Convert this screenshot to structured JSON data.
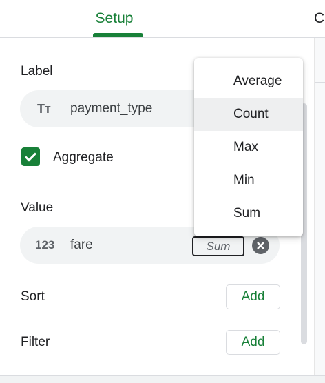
{
  "tabs": [
    {
      "label": "Setup",
      "active": true
    },
    {
      "label": "C",
      "active": false
    }
  ],
  "colors": {
    "accent": "#188038",
    "chip_bg": "#f1f3f4",
    "text": "#202124"
  },
  "label_section": {
    "heading": "Label",
    "field": {
      "icon": "text-type-icon",
      "icon_glyph": "Tт",
      "name": "payment_type"
    }
  },
  "aggregate": {
    "label": "Aggregate",
    "checked": true
  },
  "value_section": {
    "heading": "Value",
    "field": {
      "icon": "number-type-icon",
      "icon_glyph": "123",
      "name": "fare",
      "aggregation": "Sum"
    }
  },
  "sort": {
    "heading": "Sort",
    "add_label": "Add"
  },
  "filter": {
    "heading": "Filter",
    "add_label": "Add"
  },
  "aggregation_menu": {
    "items": [
      "Average",
      "Count",
      "Max",
      "Min",
      "Sum"
    ],
    "highlighted": "Count"
  }
}
